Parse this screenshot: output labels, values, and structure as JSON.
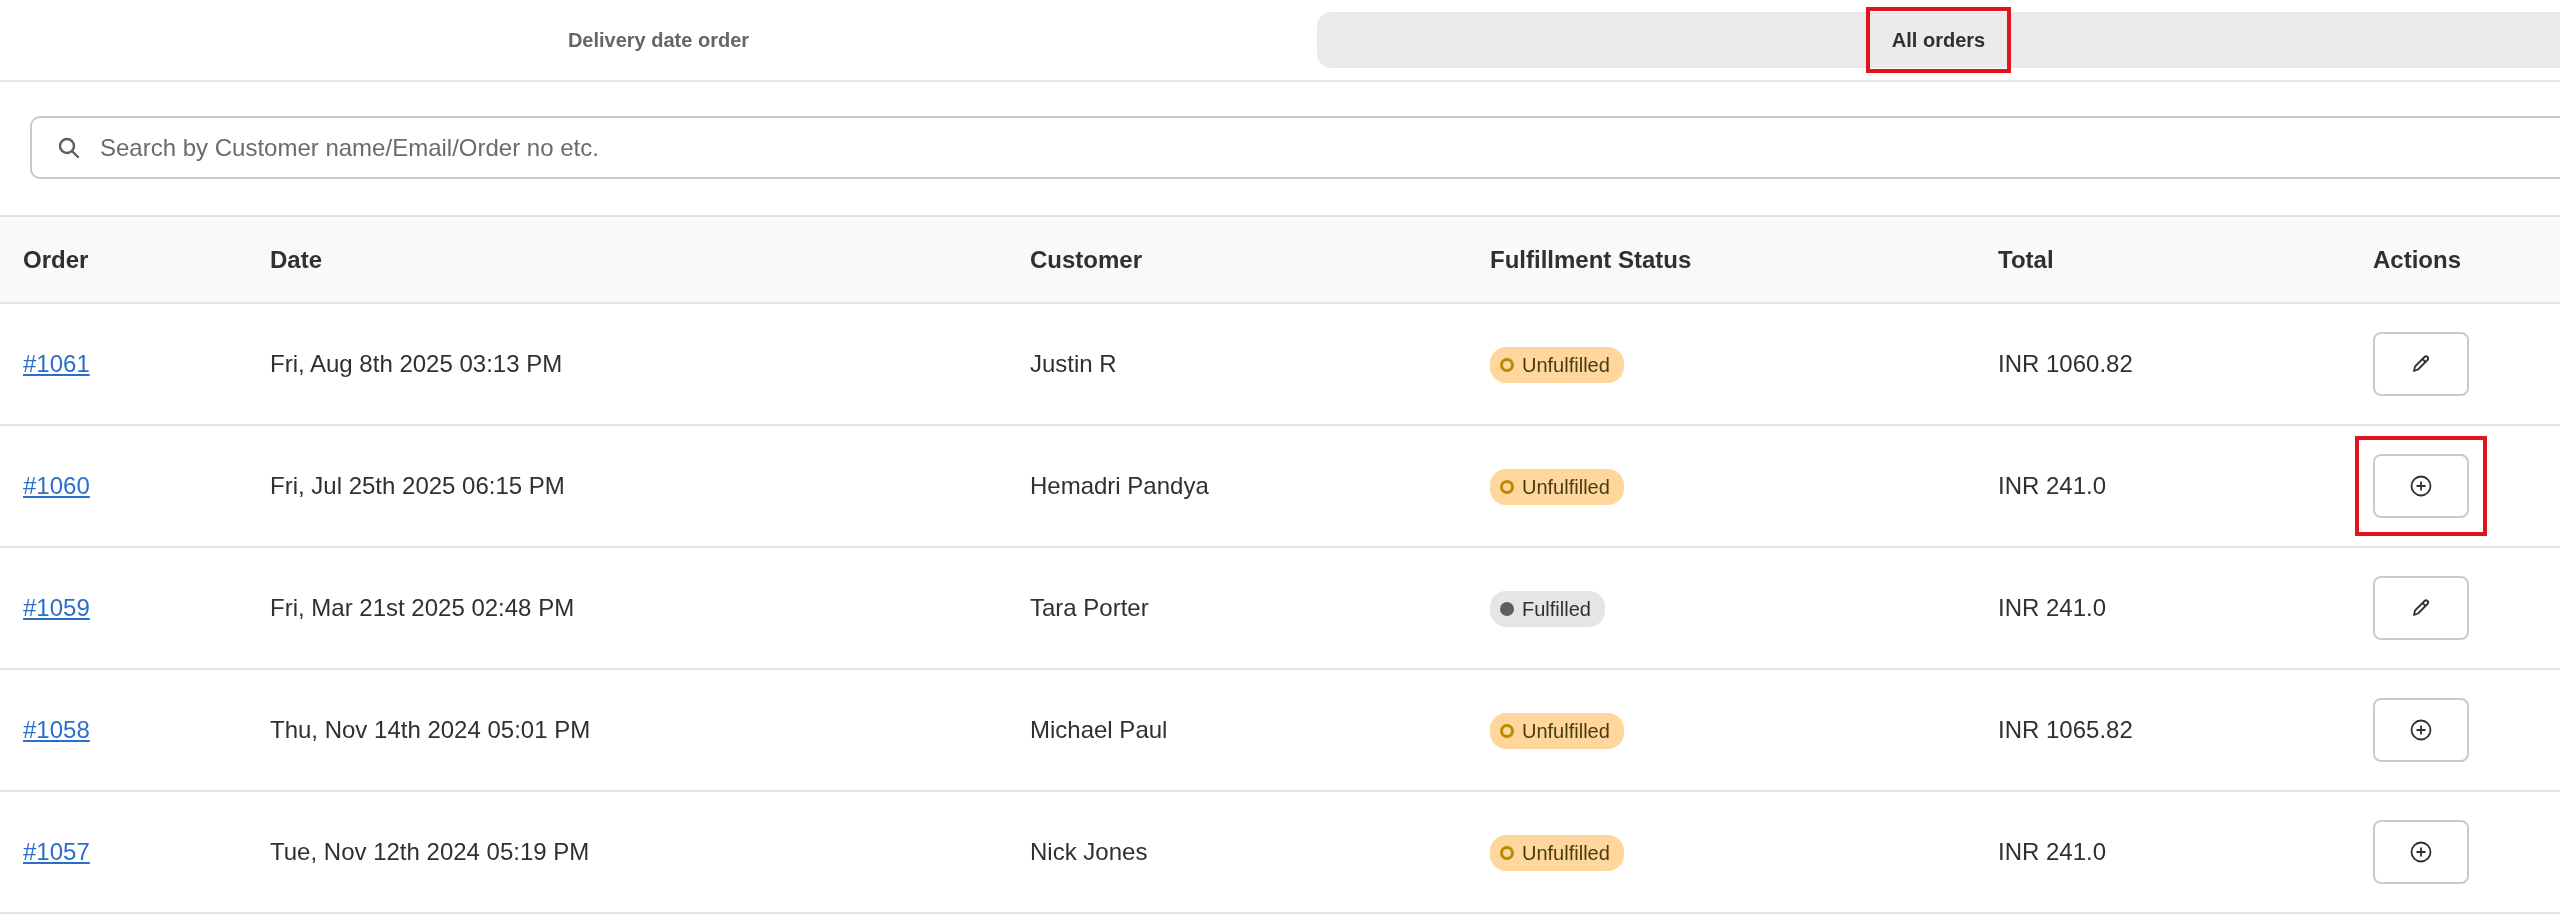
{
  "tabs": [
    {
      "label": "Delivery date order",
      "selected": false,
      "highlighted": false
    },
    {
      "label": "All orders",
      "selected": true,
      "highlighted": true
    }
  ],
  "search": {
    "placeholder": "Search by Customer name/Email/Order no etc."
  },
  "table": {
    "columns": [
      "Order",
      "Date",
      "Customer",
      "Fulfillment Status",
      "Total",
      "Actions"
    ],
    "rows": [
      {
        "order": "#1061",
        "date": "Fri, Aug 8th 2025 03:13 PM",
        "customer": "Justin R",
        "status": {
          "label": "Unfulfilled",
          "kind": "unfulfilled"
        },
        "total": "INR 1060.82",
        "action": {
          "kind": "edit",
          "highlighted": false
        }
      },
      {
        "order": "#1060",
        "date": "Fri, Jul 25th 2025 06:15 PM",
        "customer": "Hemadri Pandya",
        "status": {
          "label": "Unfulfilled",
          "kind": "unfulfilled"
        },
        "total": "INR 241.0",
        "action": {
          "kind": "add",
          "highlighted": true
        }
      },
      {
        "order": "#1059",
        "date": "Fri, Mar 21st 2025 02:48 PM",
        "customer": "Tara Porter",
        "status": {
          "label": "Fulfilled",
          "kind": "fulfilled"
        },
        "total": "INR 241.0",
        "action": {
          "kind": "edit",
          "highlighted": false
        }
      },
      {
        "order": "#1058",
        "date": "Thu, Nov 14th 2024 05:01 PM",
        "customer": "Michael Paul",
        "status": {
          "label": "Unfulfilled",
          "kind": "unfulfilled"
        },
        "total": "INR 1065.82",
        "action": {
          "kind": "add",
          "highlighted": false
        }
      },
      {
        "order": "#1057",
        "date": "Tue, Nov 12th 2024 05:19 PM",
        "customer": "Nick Jones",
        "status": {
          "label": "Unfulfilled",
          "kind": "unfulfilled"
        },
        "total": "INR 241.0",
        "action": {
          "kind": "add",
          "highlighted": false
        }
      }
    ]
  }
}
